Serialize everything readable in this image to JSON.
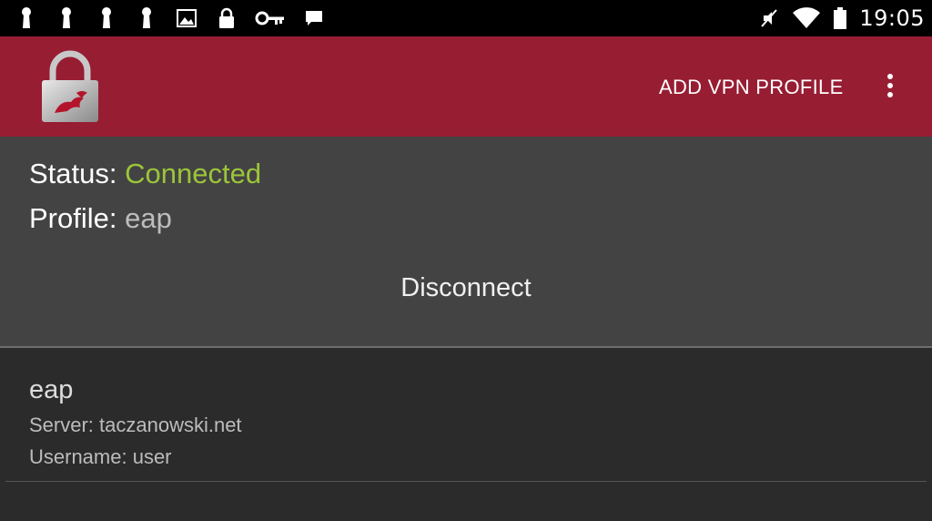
{
  "status_bar": {
    "time": "19:05",
    "left_icons": [
      "notification-lock-icon",
      "notification-lock-icon",
      "notification-lock-icon",
      "notification-lock-icon",
      "image-icon",
      "lock-icon",
      "key-icon",
      "message-icon"
    ],
    "right_icons": [
      "muted-icon",
      "wifi-icon",
      "battery-icon"
    ]
  },
  "action_bar": {
    "add_vpn_label": "ADD VPN PROFILE",
    "color": "#971d33"
  },
  "status": {
    "status_label": "Status:",
    "status_value": "Connected",
    "status_color": "#9bc53a",
    "profile_label": "Profile:",
    "profile_value": "eap",
    "disconnect_label": "Disconnect"
  },
  "profiles": [
    {
      "name": "eap",
      "server": "Server: taczanowski.net",
      "username": "Username: user"
    }
  ]
}
